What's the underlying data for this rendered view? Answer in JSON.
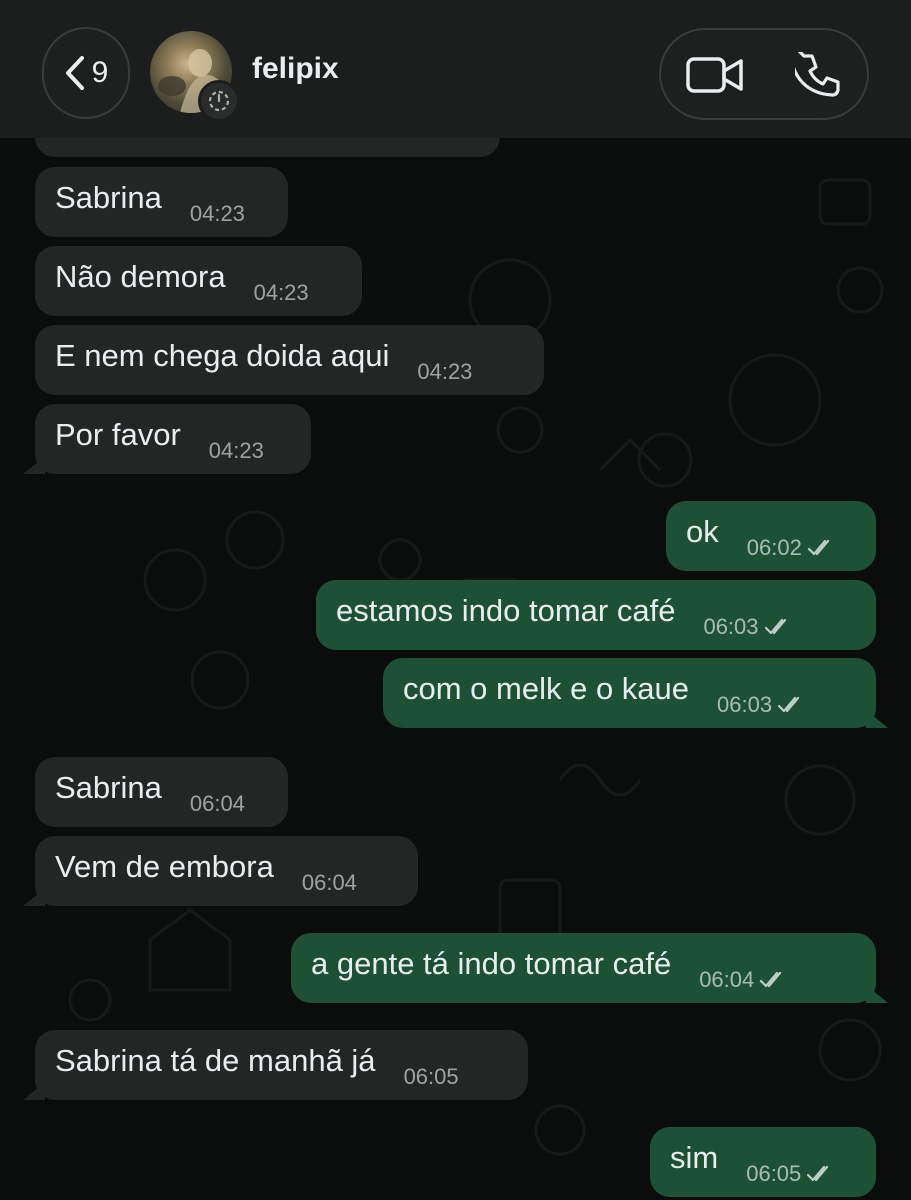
{
  "header": {
    "back_count": "9",
    "contact_name": "felipix",
    "icons": [
      "chevron-left-icon",
      "status-ring-icon",
      "video-camera-icon",
      "phone-icon"
    ]
  },
  "messages": [
    {
      "dir": "in",
      "text": "Sabrina",
      "time": "04:23"
    },
    {
      "dir": "in",
      "text": "Não demora",
      "time": "04:23"
    },
    {
      "dir": "in",
      "text": "E nem chega doida aqui",
      "time": "04:23"
    },
    {
      "dir": "in",
      "text": "Por favor",
      "time": "04:23"
    },
    {
      "dir": "out",
      "text": "ok",
      "time": "06:02"
    },
    {
      "dir": "out",
      "text": "estamos indo tomar café",
      "time": "06:03"
    },
    {
      "dir": "out",
      "text": "com o melk e o kaue",
      "time": "06:03"
    },
    {
      "dir": "in",
      "text": "Sabrina",
      "time": "06:04"
    },
    {
      "dir": "in",
      "text": "Vem de embora",
      "time": "06:04"
    },
    {
      "dir": "out",
      "text": "a gente tá indo tomar café",
      "time": "06:04"
    },
    {
      "dir": "in",
      "text": "Sabrina tá de manhã já",
      "time": "06:05"
    },
    {
      "dir": "out",
      "text": "sim",
      "time": "06:05"
    }
  ],
  "colors": {
    "background": "#0b0d0c",
    "header": "#1c1d1d",
    "incoming_bubble": "#242626",
    "outgoing_bubble": "#1d5135",
    "read_ticks": "#e9edef"
  }
}
